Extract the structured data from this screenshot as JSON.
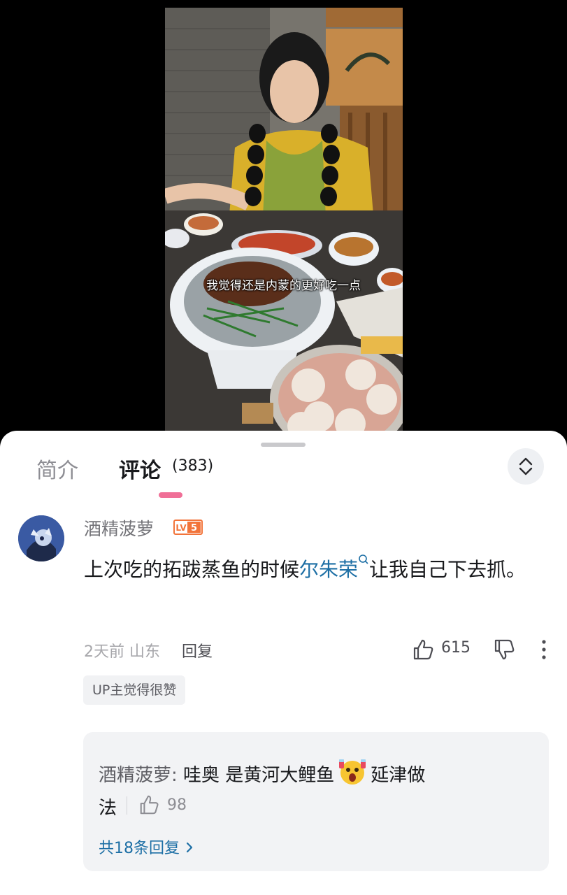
{
  "video": {
    "subtitle": "我觉得还是内蒙的更好吃一点"
  },
  "tabs": {
    "intro_label": "简介",
    "comments_label": "评论",
    "comments_count": "(383)"
  },
  "icons": {
    "sort": "chevron-up-down-icon",
    "like": "thumbs-up-icon",
    "dislike": "thumbs-down-icon",
    "more": "more-vertical-icon",
    "search": "search-icon",
    "more_replies": "chevron-right-icon",
    "emoji": "surprised-face-emoji"
  },
  "comment": {
    "username": "酒精菠萝",
    "level": "LV5",
    "text_before": "上次吃的拓跋蒸鱼的时候",
    "link_text": "尔朱荣",
    "text_after": "让我自己下去抓。",
    "time": "2天前",
    "location": "山东",
    "reply_label": "回复",
    "likes": "615",
    "up_badge": "UP主觉得很赞"
  },
  "reply": {
    "author": "酒精菠萝:",
    "text_part1": "哇奥 是黄河大鲤鱼",
    "text_part2": "延津做",
    "text_part3": "法",
    "likes": "98",
    "more_label": "共18条回复"
  },
  "colors": {
    "accent_pink": "#f06f97",
    "link_blue": "#1d6fa5",
    "level_orange": "#f2743a"
  }
}
